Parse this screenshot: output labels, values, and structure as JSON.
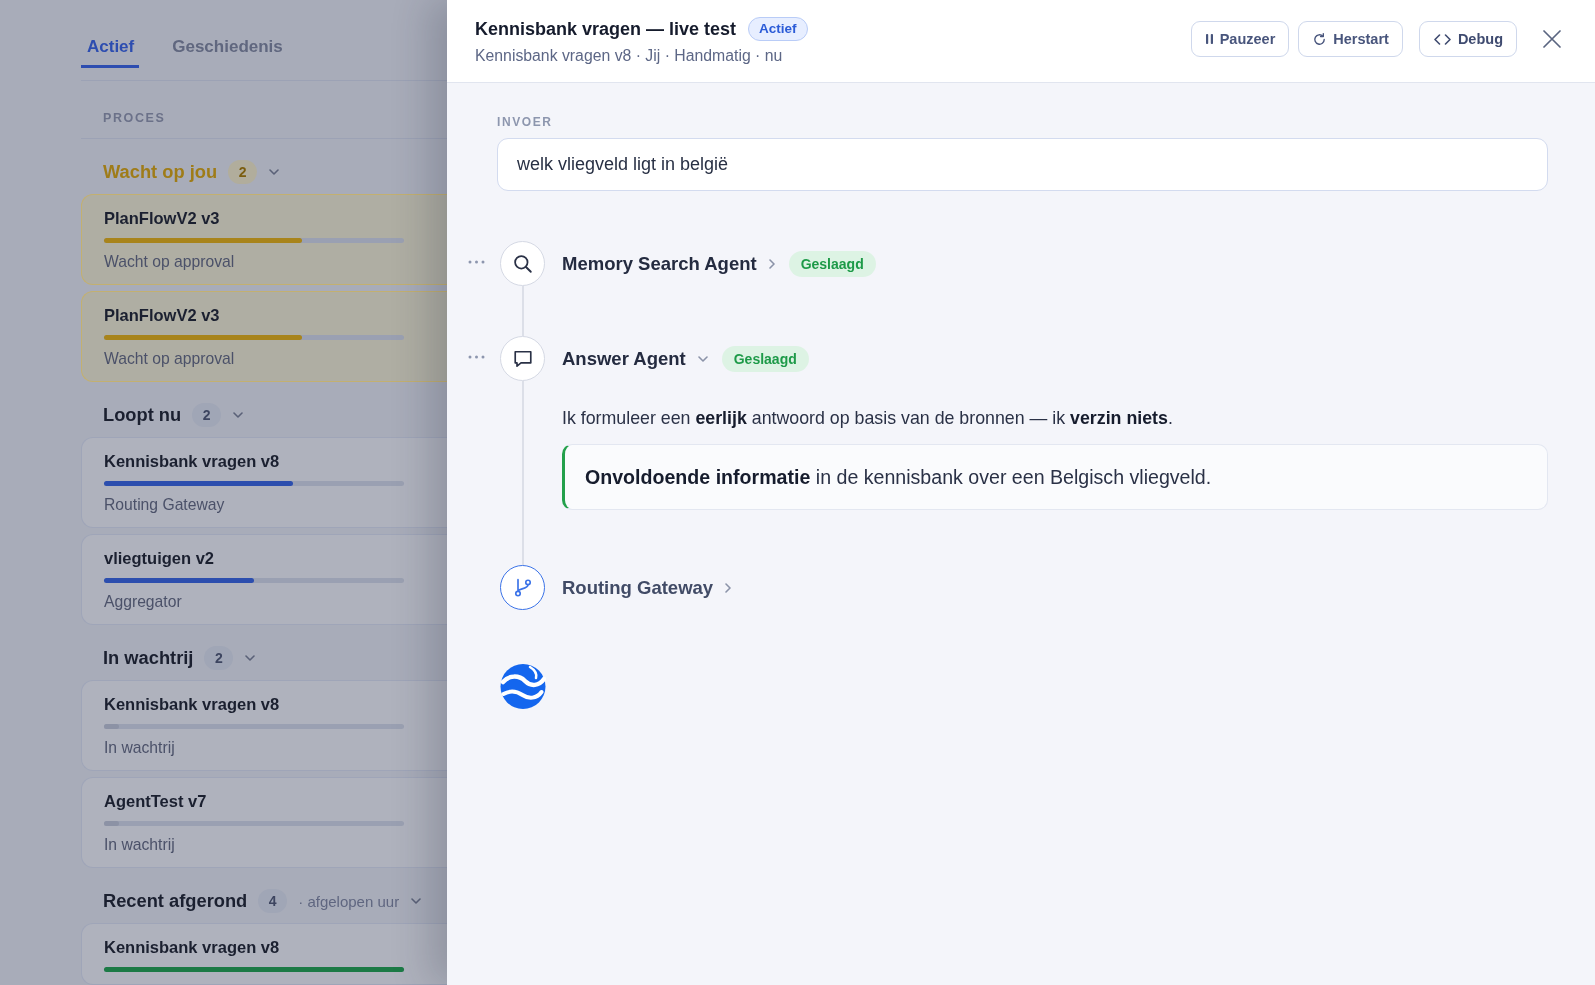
{
  "sidebar": {
    "tabs": [
      {
        "label": "Actief",
        "selected": true
      },
      {
        "label": "Geschiedenis",
        "selected": false
      }
    ],
    "section_label": "PROCES",
    "groups": [
      {
        "title": "Wacht op jou",
        "count": "2",
        "kind": "attention",
        "expanded": true,
        "cards": [
          {
            "title": "PlanFlowV2 v3",
            "level": 0.66,
            "color": "#a8841b",
            "status": "Wacht op approval"
          },
          {
            "title": "PlanFlowV2 v3",
            "level": 0.66,
            "color": "#a8841b",
            "status": "Wacht op approval"
          }
        ]
      },
      {
        "title": "Loopt nu",
        "count": "2",
        "kind": "plain",
        "expanded": true,
        "cards": [
          {
            "title": "Kennisbank vragen v8",
            "level": 0.63,
            "color": "#2c4eae",
            "status": "Routing Gateway"
          },
          {
            "title": "vliegtuigen v2",
            "level": 0.5,
            "color": "#2c4eae",
            "status": "Aggregator"
          }
        ]
      },
      {
        "title": "In wachtrij",
        "count": "2",
        "kind": "plain",
        "expanded": true,
        "cards": [
          {
            "title": "Kennisbank vragen v8",
            "level": 0.05,
            "color": "#8c92a5",
            "status": "In wachtrij"
          },
          {
            "title": "AgentTest v7",
            "level": 0.05,
            "color": "#8c92a5",
            "status": "In wachtrij"
          }
        ]
      },
      {
        "title": "Recent afgerond",
        "count": "4",
        "note": "· afgelopen uur",
        "kind": "plain",
        "expanded": true,
        "cards": [
          {
            "title": "Kennisbank vragen v8",
            "level": 1,
            "color": "#1c7a46"
          }
        ]
      }
    ]
  },
  "drawer": {
    "title": "Kennisbank vragen — live test",
    "badge": "Actief",
    "subtitle": "Kennisbank vragen v8 · Jij · Handmatig · nu",
    "buttons": [
      {
        "label": "Pauzeer",
        "kind": "pause"
      },
      {
        "label": "Herstart",
        "kind": "restart"
      },
      {
        "label": "Debug",
        "kind": "debug"
      }
    ],
    "input": {
      "label": "INVOER",
      "value": "welk vliegveld ligt in belgië"
    },
    "steps": [
      {
        "name": "Memory Search Agent",
        "kind": "search",
        "expanded": false,
        "active": false,
        "status": "Geslaagd"
      },
      {
        "name": "Answer Agent",
        "kind": "answer",
        "expanded": true,
        "active": false,
        "status": "Geslaagd",
        "description": "Ik formuleer een **eerlijk** antwoord op basis van de bronnen — ik **verzin niets**.",
        "result": "**Onvoldoende informatie** in de kennisbank over een Belgisch vliegveld."
      },
      {
        "name": "Routing Gateway",
        "kind": "router",
        "expanded": false,
        "active": true
      }
    ]
  }
}
